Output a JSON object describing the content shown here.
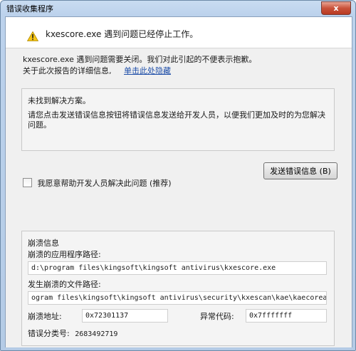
{
  "window": {
    "title": "错误收集程序",
    "close_label": "x"
  },
  "header": {
    "message": "kxescore.exe 遇到问题已经停止工作。"
  },
  "description": {
    "line1": "kxescore.exe 遇到问题需要关闭。我们对此引起的不便表示抱歉。",
    "details_prefix": "关于此次报告的详细信息,",
    "details_link": "单击此处隐藏"
  },
  "solution": {
    "title": "未找到解决方案。",
    "body": "请您点击发送错误信息按钮将错误信息发送给开发人员，以便我们更加及时的为您解决问题。"
  },
  "send_button": "发送错误信息 (B)",
  "help_checkbox": {
    "label": "我愿意帮助开发人员解决此问题 (推荐)",
    "checked": false
  },
  "crash_info": {
    "title": "崩溃信息",
    "app_path_label": "崩溃的应用程序路径:",
    "app_path": "d:\\program files\\kingsoft\\kingsoft antivirus\\kxescore.exe",
    "file_path_label": "发生崩溃的文件路径:",
    "file_path": "ogram files\\kingsoft\\kingsoft antivirus\\security\\kxescan\\kae\\kaecorea.dat",
    "address_label": "崩溃地址:",
    "address": "0x72301137",
    "exception_label": "异常代码:",
    "exception": "0x7fffffff",
    "category_label": "错误分类号:",
    "category": "2683492719"
  },
  "icons": {
    "warning": "warning-icon",
    "close": "close-icon"
  },
  "colors": {
    "link": "#1e4ea8",
    "close_button": "#c9523a",
    "title_bar": "#bcd2ec"
  }
}
